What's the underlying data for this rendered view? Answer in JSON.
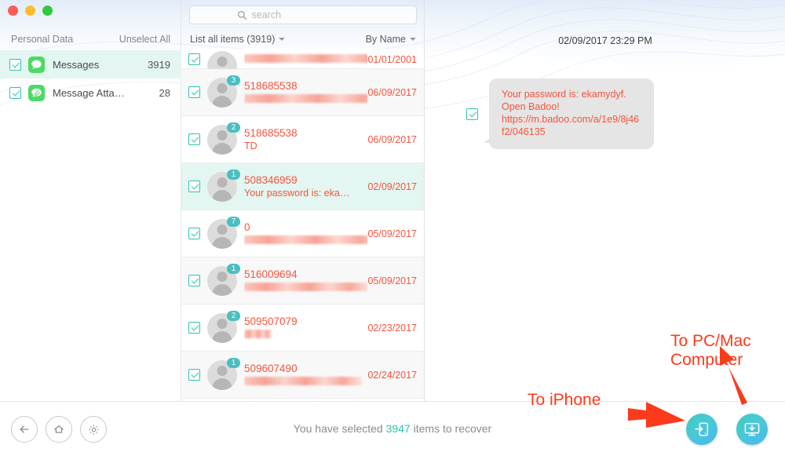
{
  "window": {
    "controls": [
      "close",
      "minimize",
      "maximize"
    ]
  },
  "sidebar": {
    "header_title": "Personal Data",
    "unselect_all": "Unselect All",
    "items": [
      {
        "label": "Messages",
        "count": "3919",
        "icon": "messages-icon",
        "selected": true
      },
      {
        "label": "Message Atta…",
        "count": "28",
        "icon": "message-attachments-icon",
        "selected": false
      }
    ]
  },
  "search": {
    "placeholder": "search",
    "value": "",
    "icon": "search-icon"
  },
  "list_controls": {
    "filter_label": "List all items (3919)",
    "sort_label": "By Name"
  },
  "list": {
    "rows": [
      {
        "title": "",
        "sub": "",
        "date": "01/01/2001",
        "badge": "",
        "clipped": true,
        "redact_title": 190,
        "redact_sub": 0,
        "selected": false,
        "checked": true
      },
      {
        "title": "518685538",
        "sub": "",
        "date": "06/09/2017",
        "badge": "3",
        "redact_sub": 180,
        "selected": false,
        "checked": true
      },
      {
        "title": "518685538",
        "sub": "TD",
        "date": "06/09/2017",
        "badge": "2",
        "redact_sub": 0,
        "selected": false,
        "checked": true
      },
      {
        "title": "508346959",
        "sub": "Your password is: eka…",
        "date": "02/09/2017",
        "badge": "1",
        "redact_sub": 0,
        "selected": true,
        "checked": true
      },
      {
        "title": "0",
        "sub": "",
        "date": "05/09/2017",
        "badge": "7",
        "redact_sub": 175,
        "selected": false,
        "checked": true
      },
      {
        "title": "516009694",
        "sub": "",
        "date": "05/09/2017",
        "badge": "1",
        "redact_sub": 160,
        "selected": false,
        "checked": true
      },
      {
        "title": "509507079",
        "sub": "",
        "date": "02/23/2017",
        "badge": "2",
        "redact_sub": 35,
        "selected": false,
        "checked": true
      },
      {
        "title": "509607490",
        "sub": "",
        "date": "02/24/2017",
        "badge": "1",
        "redact_sub": 150,
        "selected": false,
        "checked": true
      }
    ]
  },
  "message_pane": {
    "timestamp": "02/09/2017 23:29 PM",
    "bubble_text": "Your password is: ekamydyf. Open Badoo! https://m.badoo.com/a/1e9/8j46f2/046135",
    "checked": true
  },
  "bottom_bar": {
    "back_icon": "back-arrow-icon",
    "home_icon": "home-icon",
    "settings_icon": "gear-icon",
    "status_prefix": "You have selected ",
    "status_count": "3947",
    "status_suffix": " items to recover",
    "recover_to_device_icon": "recover-to-iphone-icon",
    "recover_to_computer_icon": "recover-to-computer-icon"
  },
  "annotations": {
    "to_iphone": "To iPhone",
    "to_computer": "To PC/Mac\nComputer"
  },
  "colors": {
    "accent_teal": "#2fc2b0",
    "badge_teal": "#49bfc0",
    "list_red": "#f4553d",
    "annotation_red": "#fb3b1b",
    "selected_row": "#e3f6f1"
  }
}
